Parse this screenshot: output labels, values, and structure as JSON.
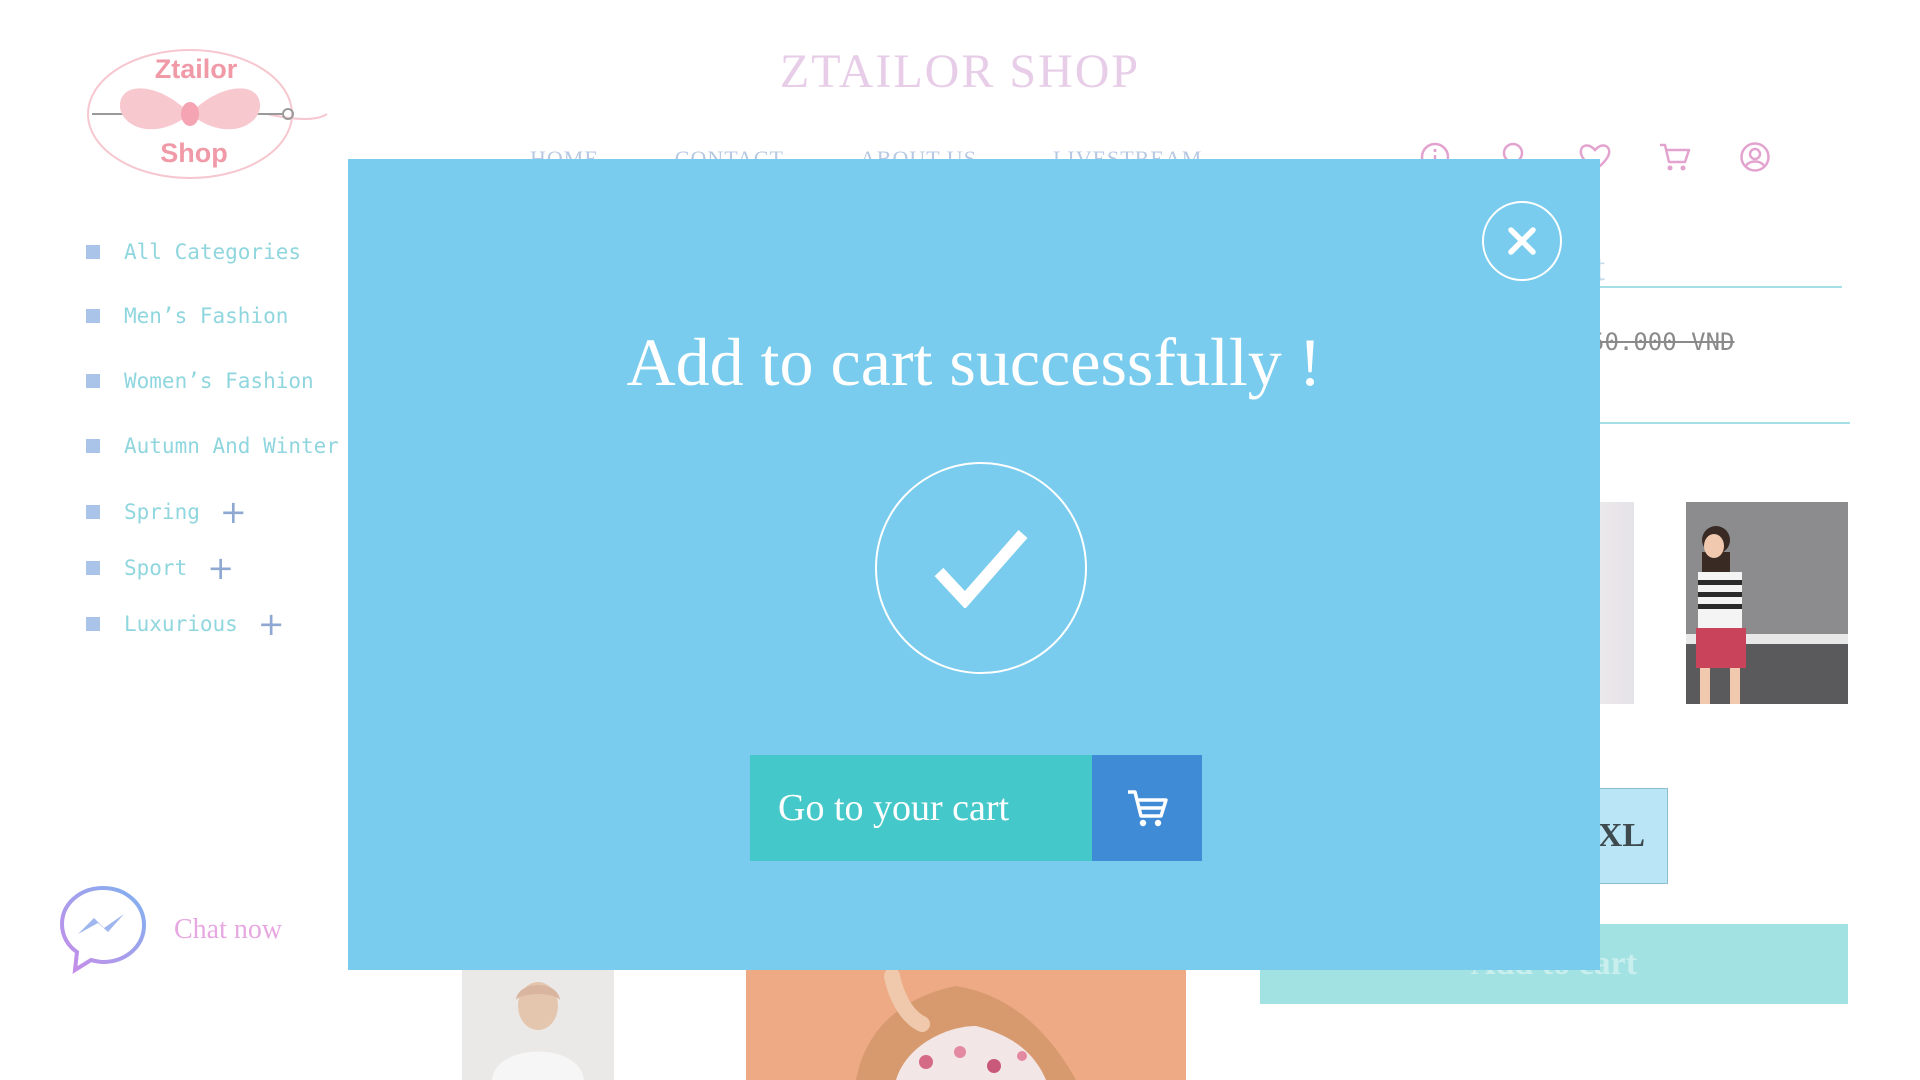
{
  "logo": {
    "line1": "Ztailor",
    "line2": "Shop"
  },
  "header": {
    "title": "ZTAILOR SHOP",
    "nav": [
      "HOME",
      "CONTACT",
      "ABOUT US",
      "LIVESTREAM"
    ],
    "icons": [
      "info-icon",
      "search-icon",
      "heart-icon",
      "cart-icon",
      "account-icon"
    ]
  },
  "sidebar": {
    "categories": [
      {
        "label": "All Categories",
        "expandable": false
      },
      {
        "label": "Men’s Fashion",
        "expandable": false
      },
      {
        "label": "Women’s Fashion",
        "expandable": false
      },
      {
        "label": "Autumn And Winter",
        "expandable": false
      },
      {
        "label": "Spring",
        "expandable": true
      },
      {
        "label": "Sport",
        "expandable": true
      },
      {
        "label": "Luxurious",
        "expandable": true
      }
    ],
    "expand_symbol": "+"
  },
  "chat": {
    "label": "Chat now",
    "icon": "messenger-icon"
  },
  "product": {
    "title_partial": "rt",
    "old_price_partial": "50.000 VND",
    "size_partial": "XL",
    "add_to_cart": "Add to cart"
  },
  "modal": {
    "title": "Add to cart successfully !",
    "check_icon": "checkmark-icon",
    "close_icon": "close-icon",
    "goto_label": "Go to your cart",
    "goto_icon": "cart-icon"
  },
  "colors": {
    "modal_bg": "#79cced",
    "goto_bg": "#45c8c9",
    "goto_icon_bg": "#3f8bd6",
    "logo_pink": "#f09aa8",
    "brand_title": "#e7cde7"
  }
}
